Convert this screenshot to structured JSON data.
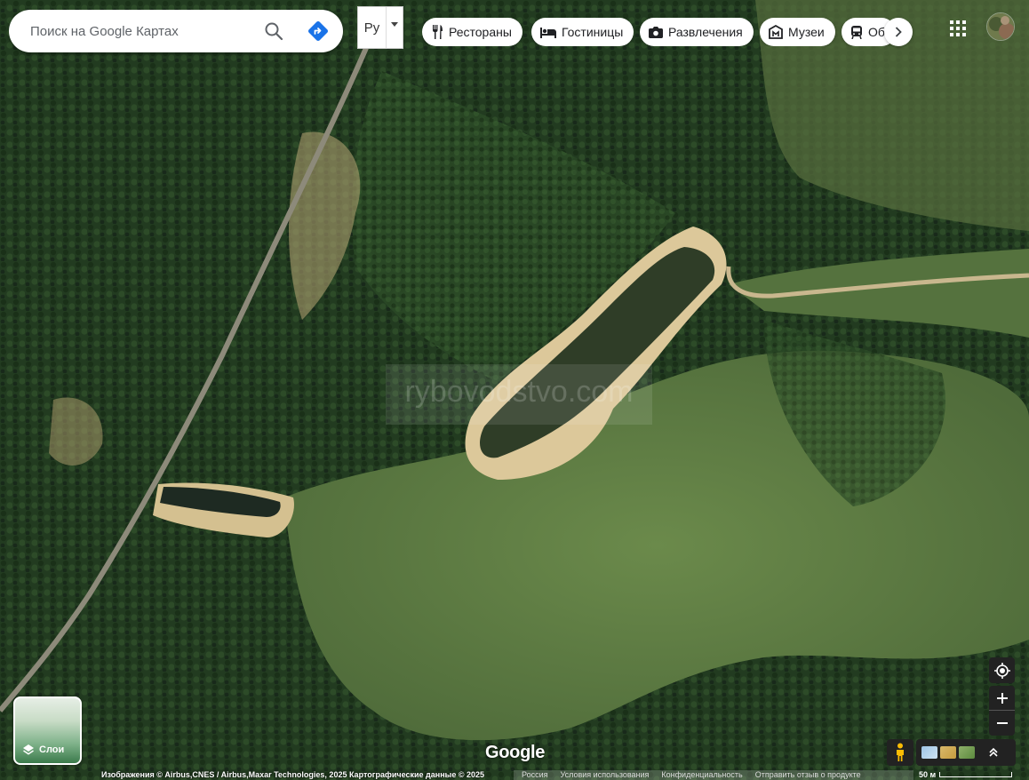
{
  "search": {
    "placeholder": "Поиск на Google Картах"
  },
  "language": {
    "label": "Ру"
  },
  "chips": [
    {
      "label": "Рестораны",
      "icon": "fork-knife-icon"
    },
    {
      "label": "Гостиницы",
      "icon": "bed-icon"
    },
    {
      "label": "Развлечения",
      "icon": "camera-icon"
    },
    {
      "label": "Музеи",
      "icon": "museum-icon"
    },
    {
      "label": "Об",
      "icon": "transit-icon"
    }
  ],
  "map": {
    "view": "satellite",
    "watermark": "rybovodstvo.com"
  },
  "layers": {
    "label": "Слои"
  },
  "logo": {
    "text": "Google"
  },
  "footer": {
    "attribution": "Изображения © Airbus,CNES / Airbus,Maxar Technologies, 2025 Картографические данные ©  2025",
    "links": [
      "Россия",
      "Условия использования",
      "Конфиденциальность",
      "Отправить отзыв о продукте"
    ],
    "scale": "50 м"
  },
  "colors": {
    "directions": "#1a73e8",
    "forest": "#2a4626",
    "meadow": "#5d7a42",
    "water": "#2d3a26",
    "sand": "#d9c08e"
  }
}
